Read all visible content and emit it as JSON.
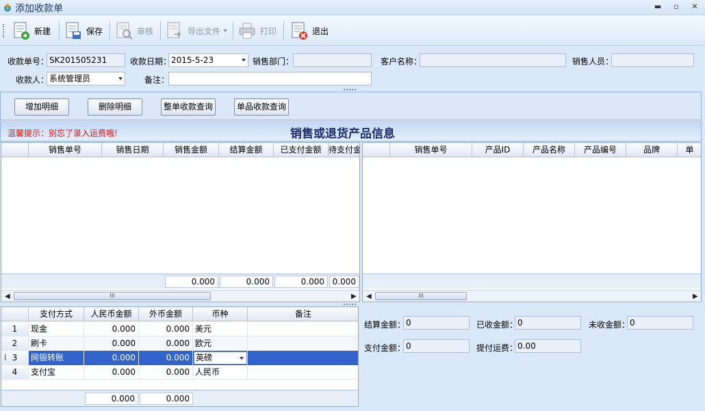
{
  "window": {
    "title": "添加收款单",
    "minimize_glyph": "▬",
    "restore_glyph": "▫",
    "close_glyph": "✕"
  },
  "toolbar": {
    "new_label": "新建",
    "save_label": "保存",
    "audit_label": "审核",
    "export_label": "导出文件",
    "print_label": "打印",
    "exit_label": "退出"
  },
  "form": {
    "receipt_no_label": "收款单号：",
    "receipt_no_value": "SK201505231",
    "receipt_date_label": "收款日期：",
    "receipt_date_value": "2015-5-23",
    "sales_dept_label": "销售部门：",
    "sales_dept_value": "",
    "customer_label": "客户名称：",
    "customer_value": "",
    "salesperson_label": "销售人员：",
    "salesperson_value": "",
    "payee_label": "收款人：",
    "payee_value": "系统管理员",
    "remark_label": "备注：",
    "remark_value": ""
  },
  "actions": {
    "add_detail": "增加明细",
    "delete_detail": "删除明细",
    "order_query": "整单收款查询",
    "item_query": "单品收款查询"
  },
  "hint": "温馨提示：别忘了录入运费哦!",
  "section_title": "销售或退货产品信息",
  "left_grid": {
    "columns": [
      "",
      "销售单号",
      "销售日期",
      "销售金额",
      "结算金额",
      "已支付金额",
      "待支付金额"
    ],
    "footer": [
      "0.000",
      "0.000",
      "0.000",
      "0.000"
    ]
  },
  "right_grid": {
    "columns": [
      "",
      "销售单号",
      "产品ID",
      "产品名称",
      "产品编号",
      "品牌",
      "单"
    ]
  },
  "payment_grid": {
    "columns": [
      "",
      "支付方式",
      "人民币金额",
      "外币金额",
      "币种",
      "备注"
    ],
    "rows": [
      {
        "no": "1",
        "method": "现金",
        "rmb": "0.000",
        "foreign": "0.000",
        "currency": "美元",
        "remark": ""
      },
      {
        "no": "2",
        "method": "刷卡",
        "rmb": "0.000",
        "foreign": "0.000",
        "currency": "欧元",
        "remark": ""
      },
      {
        "no": "3",
        "method": "网银转账",
        "rmb": "0.000",
        "foreign": "0.000",
        "currency": "英磅",
        "remark": ""
      },
      {
        "no": "4",
        "method": "支付宝",
        "rmb": "0.000",
        "foreign": "0.000",
        "currency": "人民币",
        "remark": ""
      }
    ],
    "footer": [
      "0.000",
      "0.000"
    ],
    "selected_row": 3
  },
  "summary": {
    "settle_label": "结算金额：",
    "settle_value": "0",
    "received_label": "已收金额：",
    "received_value": "0",
    "unreceived_label": "未收金额：",
    "unreceived_value": "0",
    "paid_label": "支付金额：",
    "paid_value": "0",
    "freight_label": "提付运费：",
    "freight_value": "0.00"
  },
  "scroll_thumb_glyph": "III",
  "colors": {
    "hint": "#e0140e",
    "section_title": "#1c2d6b",
    "selection": "#3163c8",
    "panel": "#dbe8f8"
  }
}
